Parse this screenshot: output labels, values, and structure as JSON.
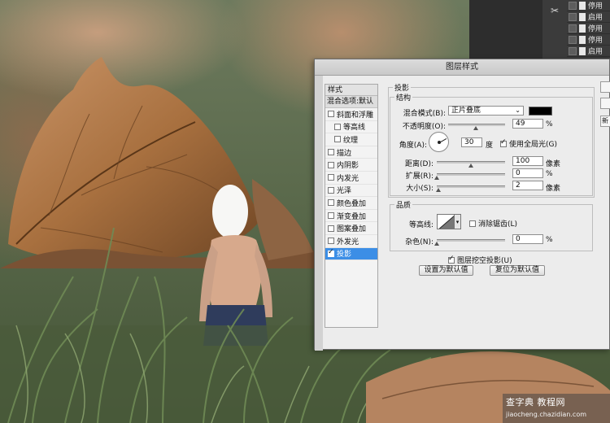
{
  "colors": {
    "accent": "#3c8ee6",
    "shadow_color": "#000000",
    "panel": "#ececec",
    "chrome_dark": "#3b3b3b"
  },
  "right_panel": {
    "items": [
      {
        "label": "停用"
      },
      {
        "label": "启用"
      },
      {
        "label": "停用"
      },
      {
        "label": "停用"
      },
      {
        "label": "启用"
      },
      {
        "label": "停用"
      }
    ]
  },
  "dialog": {
    "title": "图层样式",
    "style_list": {
      "header": "样式",
      "blend_options": "混合选项:默认",
      "items": [
        {
          "label": "斜面和浮雕",
          "checked": false,
          "indent": false,
          "active": false
        },
        {
          "label": "等高线",
          "checked": false,
          "indent": true,
          "active": false
        },
        {
          "label": "纹理",
          "checked": false,
          "indent": true,
          "active": false
        },
        {
          "label": "描边",
          "checked": false,
          "indent": false,
          "active": false
        },
        {
          "label": "内阴影",
          "checked": false,
          "indent": false,
          "active": false
        },
        {
          "label": "内发光",
          "checked": false,
          "indent": false,
          "active": false
        },
        {
          "label": "光泽",
          "checked": false,
          "indent": false,
          "active": false
        },
        {
          "label": "颜色叠加",
          "checked": false,
          "indent": false,
          "active": false
        },
        {
          "label": "渐变叠加",
          "checked": false,
          "indent": false,
          "active": false
        },
        {
          "label": "图案叠加",
          "checked": false,
          "indent": false,
          "active": false
        },
        {
          "label": "外发光",
          "checked": false,
          "indent": false,
          "active": false
        },
        {
          "label": "投影",
          "checked": true,
          "indent": false,
          "active": true
        }
      ]
    },
    "drop_shadow": {
      "section_title": "投影",
      "structure_title": "结构",
      "blend_mode_label": "混合模式(B):",
      "blend_mode_value": "正片叠底",
      "opacity_label": "不透明度(O):",
      "opacity_value": "49",
      "opacity_unit": "%",
      "angle_label": "角度(A):",
      "angle_value": "30",
      "angle_unit": "度",
      "global_light_label": "使用全局光(G)",
      "global_light_checked": true,
      "distance_label": "距离(D):",
      "distance_value": "100",
      "distance_unit": "像素",
      "spread_label": "扩展(R):",
      "spread_value": "0",
      "spread_unit": "%",
      "size_label": "大小(S):",
      "size_value": "2",
      "size_unit": "像素",
      "quality_title": "品质",
      "contour_label": "等高线:",
      "antialias_label": "消除锯齿(L)",
      "antialias_checked": false,
      "noise_label": "杂色(N):",
      "noise_value": "0",
      "noise_unit": "%",
      "knockout_label": "图层挖空投影(U)",
      "knockout_checked": true,
      "set_default_button": "设置为默认值",
      "reset_default_button": "复位为默认值"
    },
    "slider_levels": {
      "opacity": 0.49,
      "distance": 0.5,
      "spread": 0,
      "size": 0.02,
      "noise": 0
    },
    "side_buttons": [
      "",
      "",
      "新"
    ]
  },
  "watermark": {
    "line1": "查字典 教程网",
    "line2": "jiaocheng.chazidian.com"
  }
}
